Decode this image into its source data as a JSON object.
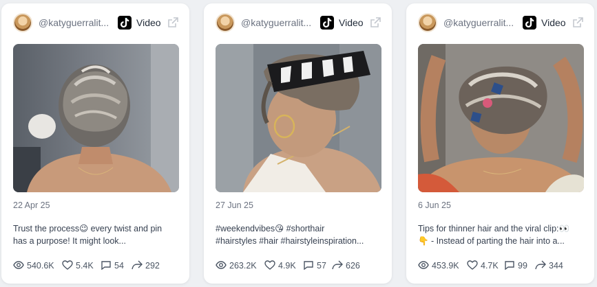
{
  "posts": [
    {
      "handle": "@katyguerralit...",
      "platform": "Video",
      "date": "22 Apr 25",
      "caption_line1": "Trust the process😉 every twist and pin",
      "caption_line2": "has a purpose! It might look...",
      "views": "540.6K",
      "likes": "5.4K",
      "comments": "54",
      "shares": "292"
    },
    {
      "handle": "@katyguerralit...",
      "platform": "Video",
      "date": "27 Jun 25",
      "caption_line1": "#weekendvibes😘 #shorthair",
      "caption_line2": "#hairstyles #hair #hairstyleinspiration...",
      "views": "263.2K",
      "likes": "4.9K",
      "comments": "57",
      "shares": "626"
    },
    {
      "handle": "@katyguerralit...",
      "platform": "Video",
      "date": "6 Jun 25",
      "caption_line1": "Tips for thinner hair and the viral clip:👀",
      "caption_line2": "👇 - Instead of parting the hair into a...",
      "views": "453.9K",
      "likes": "4.7K",
      "comments": "99",
      "shares": "344"
    }
  ],
  "icons": {
    "platform": "tiktok-icon",
    "external": "external-link-icon",
    "views": "eye-icon",
    "likes": "heart-icon",
    "comments": "comment-icon",
    "shares": "share-icon"
  }
}
